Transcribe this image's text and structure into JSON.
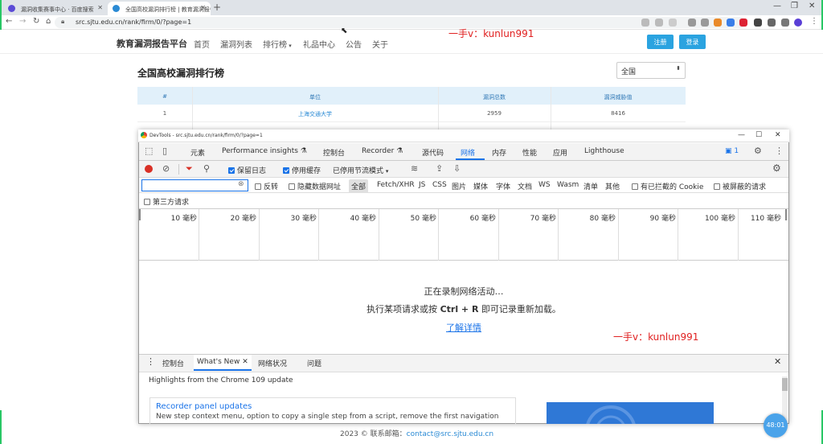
{
  "browser": {
    "tabs": [
      {
        "title": "漏洞收集赛事中心 · 百度搜索",
        "active": false
      },
      {
        "title": "全国高校漏洞排行榜 | 教育漏洞报告平台",
        "active": true
      }
    ],
    "url": "src.sjtu.edu.cn/rank/firm/0/?page=1"
  },
  "site": {
    "logo": "教育漏洞报告平台",
    "nav": [
      "首页",
      "漏洞列表",
      "排行榜",
      "礼品中心",
      "公告",
      "关于"
    ],
    "register": "注册",
    "login": "登录",
    "watermark": "一手v：kunlun991",
    "page_title": "全国高校漏洞排行榜",
    "region": "全国",
    "table": {
      "headers": [
        "#",
        "单位",
        "漏洞总数",
        "漏洞威胁值"
      ],
      "rows": [
        [
          "1",
          "上海交通大学",
          "2959",
          "8416"
        ]
      ]
    },
    "footer_prefix": "2023 © 联系邮箱：",
    "footer_email": "contact@src.sjtu.edu.cn"
  },
  "devtools": {
    "title": "DevTools - src.sjtu.edu.cn/rank/firm/0/?page=1",
    "tabs": [
      "元素",
      "Performance insights",
      "控制台",
      "Recorder",
      "源代码",
      "网络",
      "内存",
      "性能",
      "应用",
      "Lighthouse"
    ],
    "active_tab": "网络",
    "issues_count": "1",
    "toolbar": {
      "preserve_log": "保留日志",
      "disable_cache": "停用缓存",
      "throttle": "已停用节流模式"
    },
    "filters": {
      "invert": "反转",
      "hide_data_urls": "隐藏数据网址",
      "types": [
        "全部",
        "Fetch/XHR",
        "JS",
        "CSS",
        "图片",
        "媒体",
        "字体",
        "文档",
        "WS",
        "Wasm",
        "清单",
        "其他"
      ],
      "blocked_cookies": "有已拦截的 Cookie",
      "blocked_requests": "被屏蔽的请求",
      "third_party": "第三方请求"
    },
    "timeline": [
      "10 毫秒",
      "20 毫秒",
      "30 毫秒",
      "40 毫秒",
      "50 毫秒",
      "60 毫秒",
      "70 毫秒",
      "80 毫秒",
      "90 毫秒",
      "100 毫秒",
      "110 毫秒"
    ],
    "recording": "正在录制网络活动…",
    "hint_prefix": "执行某项请求或按",
    "hint_keys": "Ctrl + R",
    "hint_suffix": "即可记录重新加载。",
    "learn_more": "了解详情",
    "drawer": {
      "tabs": [
        "控制台",
        "What's New",
        "网络状况",
        "问题"
      ],
      "subtitle": "Highlights from the Chrome 109 update",
      "card_title": "Recorder panel updates",
      "card_text": "New step context menu, option to copy a single step from a script, remove the first navigation"
    }
  },
  "timer": "48:01"
}
